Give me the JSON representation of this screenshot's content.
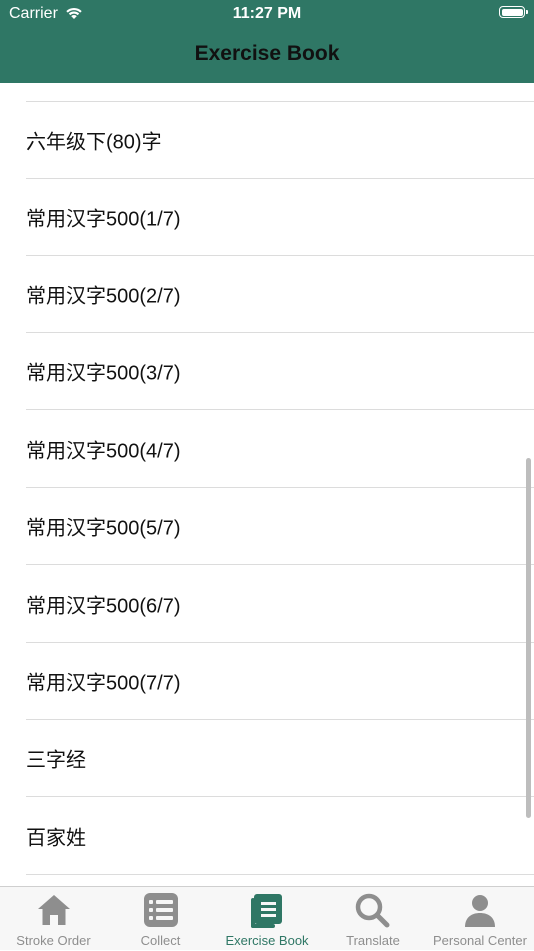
{
  "status_bar": {
    "carrier": "Carrier",
    "time": "11:27 PM"
  },
  "nav": {
    "title": "Exercise Book"
  },
  "list": {
    "items": [
      "六年级下(80)字",
      "常用汉字500(1/7)",
      "常用汉字500(2/7)",
      "常用汉字500(3/7)",
      "常用汉字500(4/7)",
      "常用汉字500(5/7)",
      "常用汉字500(6/7)",
      "常用汉字500(7/7)",
      "三字经",
      "百家姓"
    ]
  },
  "tabbar": {
    "active_color": "#2f7765",
    "inactive_color": "#8e8e8e",
    "tabs": [
      {
        "label": "Stroke Order",
        "icon": "home-icon"
      },
      {
        "label": "Collect",
        "icon": "list-icon"
      },
      {
        "label": "Exercise Book",
        "icon": "book-icon",
        "active": true
      },
      {
        "label": "Translate",
        "icon": "search-icon"
      },
      {
        "label": "Personal Center",
        "icon": "person-icon"
      }
    ]
  }
}
